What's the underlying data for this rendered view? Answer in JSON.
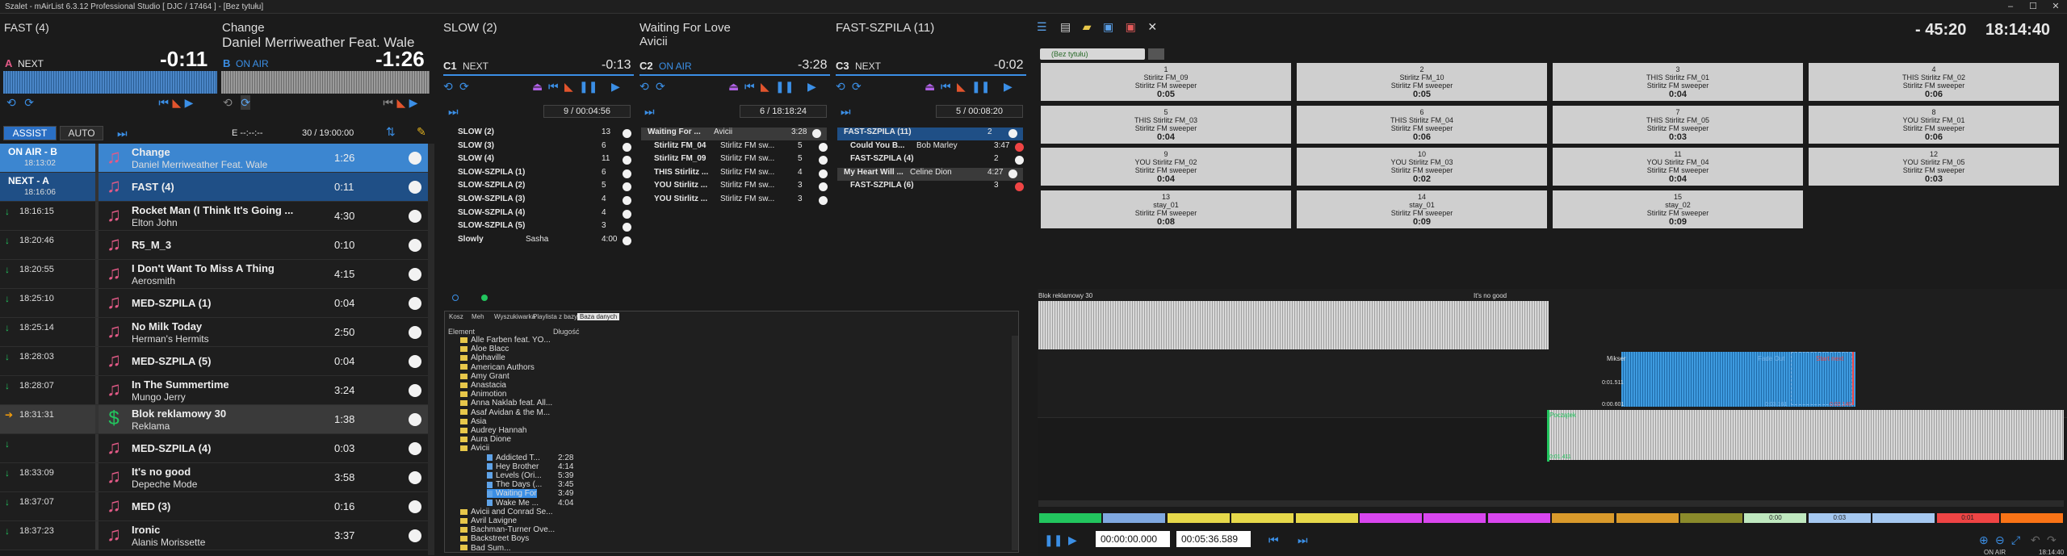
{
  "window": {
    "title": "Szalet - mAirList 6.3.12 Professional Studio [ DJC / 17464 ] - [Bez tytułu]",
    "min": "–",
    "max": "☐",
    "close": "✕"
  },
  "deckA": {
    "category": "FAST (4)",
    "label": "A",
    "state": "NEXT",
    "time": "-0:11"
  },
  "deckB": {
    "title": "Change",
    "artist": "Daniel Merriweather Feat. Wale",
    "label": "B",
    "state": "ON AIR",
    "time": "-1:26"
  },
  "assist": {
    "assist": "ASSIST",
    "auto": "AUTO",
    "e_label": "E  --:--:--",
    "counter": "30 / 19:00:00"
  },
  "playlist": [
    {
      "time1": "ON AIR - B",
      "time2": "18:13:02",
      "title": "Change",
      "artist": "Daniel Merriweather Feat. Wale",
      "dur": "1:26"
    },
    {
      "time1": "NEXT - A",
      "time2": "18:16:06",
      "title": "FAST (4)",
      "artist": "",
      "dur": "0:11"
    },
    {
      "time1": "18:16:15",
      "time2": "",
      "title": "Rocket Man (I Think It's Going ...",
      "artist": "Elton John",
      "dur": "4:30"
    },
    {
      "time1": "18:20:46",
      "time2": "",
      "title": "R5_M_3",
      "artist": "",
      "dur": "0:10"
    },
    {
      "time1": "18:20:55",
      "time2": "",
      "title": "I Don't Want To Miss A Thing",
      "artist": "Aerosmith",
      "dur": "4:15"
    },
    {
      "time1": "18:25:10",
      "time2": "",
      "title": "MED-SZPILA (1)",
      "artist": "",
      "dur": "0:04"
    },
    {
      "time1": "18:25:14",
      "time2": "",
      "title": "No Milk Today",
      "artist": "Herman's Hermits",
      "dur": "2:50"
    },
    {
      "time1": "18:28:03",
      "time2": "",
      "title": "MED-SZPILA (5)",
      "artist": "",
      "dur": "0:04"
    },
    {
      "time1": "18:28:07",
      "time2": "",
      "title": "In The Summertime",
      "artist": "Mungo Jerry",
      "dur": "3:24"
    },
    {
      "time1": "18:31:31",
      "time2": "",
      "title": "Blok reklamowy 30",
      "artist": "Reklama",
      "dur": "1:38"
    },
    {
      "time1": "",
      "time2": "",
      "title": "MED-SZPILA (4)",
      "artist": "",
      "dur": "0:03"
    },
    {
      "time1": "18:33:09",
      "time2": "",
      "title": "It's no good",
      "artist": "Depeche Mode",
      "dur": "3:58"
    },
    {
      "time1": "18:37:07",
      "time2": "",
      "title": "MED (3)",
      "artist": "",
      "dur": "0:16"
    },
    {
      "time1": "18:37:23",
      "time2": "",
      "title": "Ironic",
      "artist": "Alanis Morissette",
      "dur": "3:37"
    }
  ],
  "c1": {
    "head": "SLOW (2)",
    "label": "C1",
    "state": "NEXT",
    "time": "-0:13",
    "count": "9 / 00:04:56",
    "items": [
      [
        "SLOW (2)",
        "",
        "13"
      ],
      [
        "SLOW (3)",
        "",
        "6"
      ],
      [
        "SLOW (4)",
        "",
        "11"
      ],
      [
        "SLOW-SZPILA (1)",
        "",
        "6"
      ],
      [
        "SLOW-SZPILA (2)",
        "",
        "5"
      ],
      [
        "SLOW-SZPILA (3)",
        "",
        "4"
      ],
      [
        "SLOW-SZPILA (4)",
        "",
        "4"
      ],
      [
        "SLOW-SZPILA (5)",
        "",
        "3"
      ],
      [
        "Slowly",
        "Sasha",
        "4:00"
      ]
    ]
  },
  "c2": {
    "head": "Waiting For Love",
    "artist": "Avicii",
    "label": "C2",
    "state": "ON AIR",
    "time": "-3:28",
    "count": "6 / 18:18:24",
    "items": [
      [
        "Waiting For ...",
        "Avicii",
        "3:28"
      ],
      [
        "Stirlitz FM_04",
        "Stirlitz FM sw...",
        "5"
      ],
      [
        "Stirlitz FM_09",
        "Stirlitz FM sw...",
        "5"
      ],
      [
        "THIS Stirlitz ...",
        "Stirlitz FM sw...",
        "4"
      ],
      [
        "YOU Stirlitz ...",
        "Stirlitz FM sw...",
        "3"
      ],
      [
        "YOU Stirlitz ...",
        "Stirlitz FM sw...",
        "3"
      ]
    ]
  },
  "c3": {
    "head": "FAST-SZPILA (11)",
    "label": "C3",
    "state": "NEXT",
    "time": "-0:02",
    "count": "5 / 00:08:20",
    "items": [
      [
        "FAST-SZPILA (11)",
        "",
        "2"
      ],
      [
        "Could You B...",
        "Bob Marley",
        "3:47"
      ],
      [
        "FAST-SZPILA (4)",
        "",
        "2"
      ],
      [
        "My Heart Will ...",
        "Celine Dion",
        "4:27"
      ],
      [
        "FAST-SZPILA (6)",
        "",
        "3"
      ]
    ]
  },
  "browser": {
    "tabs": [
      "Kosz",
      "Meh",
      "Wyszukiwarka",
      "Playlista z bazy",
      "Baza danych"
    ],
    "col1": "Element",
    "col2": "Długość",
    "tree": [
      [
        "f",
        "Alle Farben feat. YO..."
      ],
      [
        "f",
        "Aloe Blacc"
      ],
      [
        "f",
        "Alphaville"
      ],
      [
        "f",
        "American Authors"
      ],
      [
        "f",
        "Amy Grant"
      ],
      [
        "f",
        "Anastacia"
      ],
      [
        "f",
        "Animotion"
      ],
      [
        "f",
        "Anna Naklab feat. All..."
      ],
      [
        "f",
        "Asaf Avidan & the M..."
      ],
      [
        "f",
        "Asia"
      ],
      [
        "f",
        "Audrey Hannah"
      ],
      [
        "f",
        "Aura Dione"
      ],
      [
        "f",
        "Avicii"
      ],
      [
        "s",
        "Addicted T...",
        "2:28"
      ],
      [
        "s",
        "Hey Brother",
        "4:14"
      ],
      [
        "s",
        "Levels (Ori...",
        "5:39"
      ],
      [
        "s",
        "The Days (...",
        "3:45"
      ],
      [
        "s",
        "Waiting For",
        "3:49"
      ],
      [
        "s",
        "Wake Me ...",
        "4:04"
      ],
      [
        "f",
        "Avicii and Conrad Se..."
      ],
      [
        "f",
        "Avril Lavigne"
      ],
      [
        "f",
        "Bachman-Turner Ove..."
      ],
      [
        "f",
        "Backstreet Boys"
      ],
      [
        "f",
        "Bad Sum..."
      ]
    ]
  },
  "clock": {
    "remaining": "- 45:20",
    "time": "18:14:40"
  },
  "carts": {
    "tab": "(Bez tytułu)",
    "cells": [
      [
        "1",
        "Stirlitz FM_09",
        "Stirlitz FM sweeper",
        "0:05"
      ],
      [
        "2",
        "Stirlitz FM_10",
        "Stirlitz FM sweeper",
        "0:05"
      ],
      [
        "3",
        "THIS Stirlitz FM_01",
        "Stirlitz FM sweeper",
        "0:04"
      ],
      [
        "4",
        "THIS Stirlitz FM_02",
        "Stirlitz FM sweeper",
        "0:06"
      ],
      [
        "5",
        "THIS Stirlitz FM_03",
        "Stirlitz FM sweeper",
        "0:04"
      ],
      [
        "6",
        "THIS Stirlitz FM_04",
        "Stirlitz FM sweeper",
        "0:06"
      ],
      [
        "7",
        "THIS Stirlitz FM_05",
        "Stirlitz FM sweeper",
        "0:03"
      ],
      [
        "8",
        "YOU Stirlitz FM_01",
        "Stirlitz FM sweeper",
        "0:06"
      ],
      [
        "9",
        "YOU Stirlitz FM_02",
        "Stirlitz FM sweeper",
        "0:04"
      ],
      [
        "10",
        "YOU Stirlitz FM_03",
        "Stirlitz FM sweeper",
        "0:02"
      ],
      [
        "11",
        "YOU Stirlitz FM_04",
        "Stirlitz FM sweeper",
        "0:04"
      ],
      [
        "12",
        "YOU Stirlitz FM_05",
        "Stirlitz FM sweeper",
        "0:03"
      ],
      [
        "13",
        "stay_01",
        "Stirlitz FM sweeper",
        "0:08"
      ],
      [
        "14",
        "stay_01",
        "Stirlitz FM sweeper",
        "0:09"
      ],
      [
        "15",
        "stay_02",
        "Stirlitz FM sweeper",
        "0:09"
      ]
    ]
  },
  "editor": {
    "label1": "Blok reklamowy 30",
    "label2": "It's no good",
    "mix": "Mikser",
    "fadeout": "Fade Out",
    "startnext": "Start next",
    "begin": "Początek",
    "t1": "0:01.511",
    "t2": "0:00.601",
    "t3": "0:03.161",
    "t4": "0:02.140",
    "t5": "0:01.411",
    "tags": [
      [
        "",
        "#22c55e"
      ],
      [
        "",
        "#7fa8e0"
      ],
      [
        "",
        "#e6d84a"
      ],
      [
        "",
        "#e6d84a"
      ],
      [
        "",
        "#e6d84a"
      ],
      [
        "",
        "#d946ef"
      ],
      [
        "",
        "#d946ef"
      ],
      [
        "",
        "#d946ef"
      ],
      [
        "",
        "#d99a2b"
      ],
      [
        "",
        "#d99a2b"
      ],
      [
        "",
        "#8a8a2b"
      ],
      [
        "0:00",
        "#bfe8bf"
      ],
      [
        "0:03",
        "#a5c8f0"
      ],
      [
        "",
        "#a5c8f0"
      ],
      [
        "0:01",
        "#ef4444"
      ],
      [
        "",
        "#f97316"
      ]
    ],
    "pos": "00:00:00.000",
    "len": "00:05:36.589",
    "onair": "ON AIR",
    "clock": "18:14:40"
  }
}
